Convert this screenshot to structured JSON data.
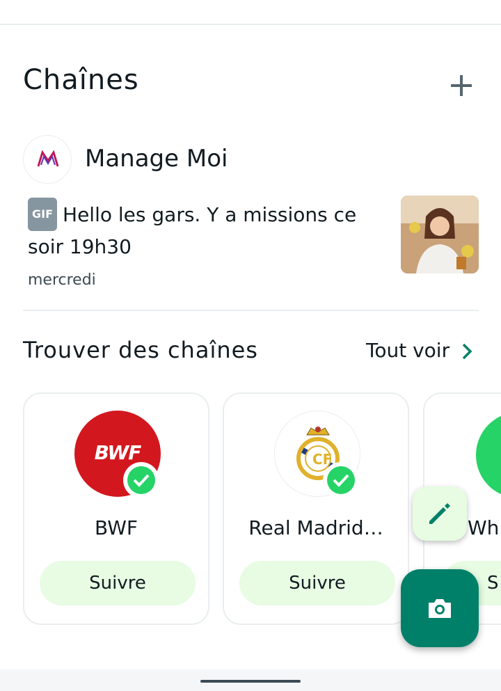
{
  "channels_section": {
    "title": "Chaînes",
    "add_icon": "plus-icon"
  },
  "channel": {
    "name": "Manage Moi",
    "gif_badge": "GIF",
    "message": "Hello les gars. Y a missions ce soir 19h30",
    "time": "mercredi",
    "thumbnail_icon": "gif-thumbnail"
  },
  "find_section": {
    "title": "Trouver des chaînes",
    "see_all": "Tout voir"
  },
  "suggestions": [
    {
      "name": "BWF",
      "logo_text": "BWF",
      "follow": "Suivre"
    },
    {
      "name": "Real Madrid…",
      "follow": "Suivre"
    },
    {
      "name": "Wh",
      "follow": "S"
    }
  ],
  "fab": {
    "edit_icon": "pencil-icon",
    "camera_icon": "camera-icon"
  },
  "colors": {
    "accent": "#008069",
    "light_green": "#e7fce3",
    "verified": "#25d366",
    "bwf_red": "#d3171e"
  }
}
